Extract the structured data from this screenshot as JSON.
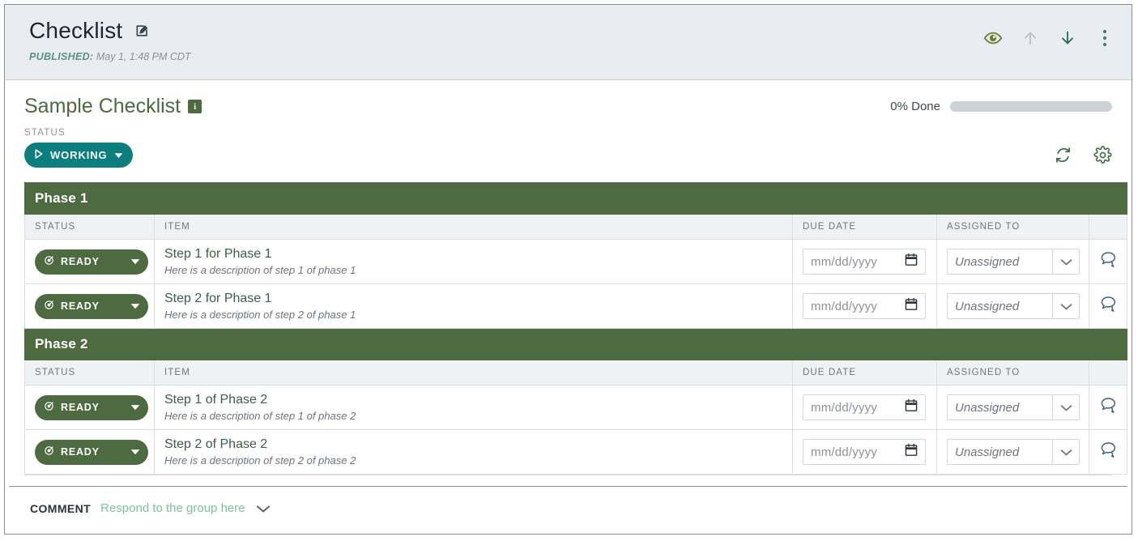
{
  "header": {
    "app_title": "Checklist",
    "edit_icon": "pencil-square-icon",
    "published_label": "PUBLISHED:",
    "published_value": "May 1, 1:48 PM CDT",
    "actions": [
      {
        "name": "preview-eye",
        "icon": "eye-icon",
        "color": "#6d7c2e"
      },
      {
        "name": "move-up",
        "icon": "arrow-up-icon",
        "color": "#b9c2c8"
      },
      {
        "name": "move-down",
        "icon": "arrow-down-icon",
        "color": "#2c6e4f"
      },
      {
        "name": "more-menu",
        "icon": "vertical-dots-icon",
        "color": "#4a7a5f"
      }
    ]
  },
  "checklist": {
    "title": "Sample Checklist",
    "info_icon": "info-icon",
    "progress_text": "0% Done",
    "progress_percent": 0,
    "status_label": "STATUS",
    "status_value": "WORKING",
    "status_icon": "play-icon",
    "status_caret": "caret-down-icon",
    "status_color": "#0c7e7e",
    "refresh_icon": "refresh-icon",
    "settings_icon": "gear-icon"
  },
  "columns": {
    "status": "STATUS",
    "item": "ITEM",
    "due_date": "DUE DATE",
    "assigned_to": "ASSIGNED TO"
  },
  "defaults": {
    "date_placeholder": "mm/dd/yyyy",
    "assignee_placeholder": "Unassigned",
    "row_status": "READY",
    "calendar_icon": "calendar-icon",
    "chevron_icon": "chevron-down-icon",
    "chat_icon": "chat-bubbles-icon",
    "status_badge_icon": "ready-refresh-icon",
    "status_caret_icon": "caret-down-icon"
  },
  "phases": [
    {
      "name": "Phase 1",
      "items": [
        {
          "status": "READY",
          "title": "Step 1 for Phase 1",
          "description": "Here is a description of step 1 of phase 1",
          "due_date": "",
          "assignee": "Unassigned"
        },
        {
          "status": "READY",
          "title": "Step 2 for Phase 1",
          "description": "Here is a description of step 2 of phase 1",
          "due_date": "",
          "assignee": "Unassigned"
        }
      ]
    },
    {
      "name": "Phase 2",
      "items": [
        {
          "status": "READY",
          "title": "Step 1 of Phase 2",
          "description": "Here is a description of step 1 of phase 2",
          "due_date": "",
          "assignee": "Unassigned"
        },
        {
          "status": "READY",
          "title": "Step 2 of Phase 2",
          "description": "Here is a description of step 2 of phase 2",
          "due_date": "",
          "assignee": "Unassigned"
        }
      ]
    }
  ],
  "comment_bar": {
    "label": "COMMENT",
    "link": "Respond to the group here",
    "caret_icon": "chevron-down-icon"
  },
  "colors": {
    "phase_green": "#4d6a40",
    "status_teal": "#0c7e7e",
    "comment_link": "#79c49b",
    "header_band": "#e9edf1"
  }
}
